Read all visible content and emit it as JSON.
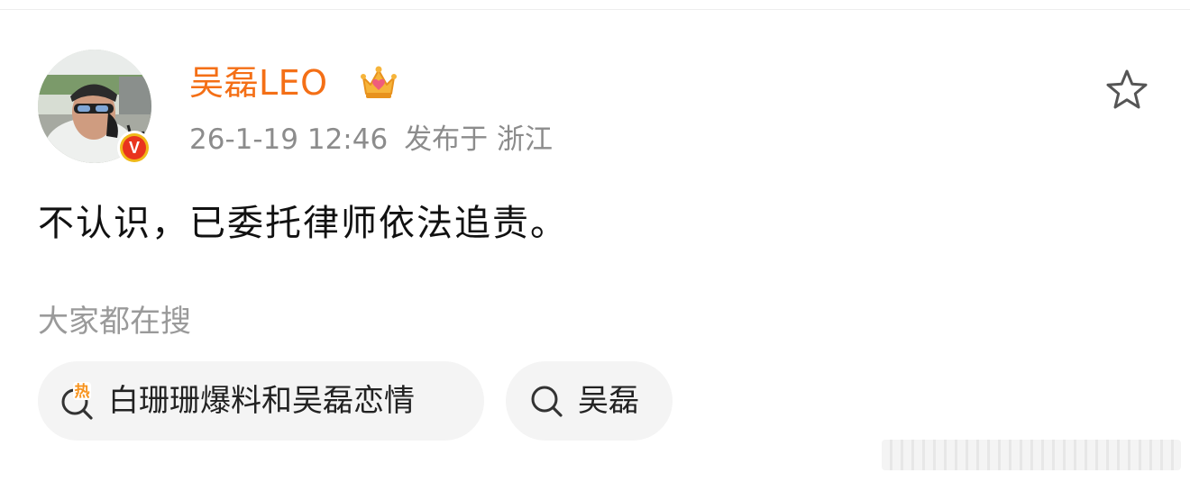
{
  "post": {
    "author": {
      "name": "吴磊LEO",
      "verified": true,
      "vip_crown": true,
      "name_color": "#f46f16"
    },
    "meta": {
      "timestamp": "26-1-19 12:46",
      "location": "发布于 浙江"
    },
    "text": "不认识，已委托律师依法追责。",
    "actions": {
      "favorite_icon": "star-outline-icon"
    }
  },
  "search_section": {
    "label": "大家都在搜",
    "chips": [
      {
        "text": "白珊珊爆料和吴磊恋情",
        "icon": "hot-search-icon",
        "badge": "热"
      },
      {
        "text": "吴磊",
        "icon": "search-icon"
      }
    ]
  },
  "colors": {
    "accent_orange": "#f46f16",
    "verified_red": "#e9341e",
    "verified_gold": "#f0b818",
    "meta_gray": "#8c8c8c",
    "chip_bg": "#f4f4f4"
  }
}
